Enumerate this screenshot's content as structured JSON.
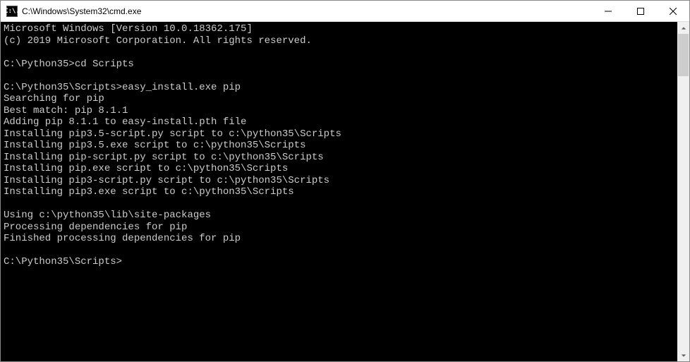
{
  "window": {
    "title": "C:\\Windows\\System32\\cmd.exe",
    "icon_text": "C:\\."
  },
  "terminal": {
    "lines": [
      "Microsoft Windows [Version 10.0.18362.175]",
      "(c) 2019 Microsoft Corporation. All rights reserved.",
      "",
      "C:\\Python35>cd Scripts",
      "",
      "C:\\Python35\\Scripts>easy_install.exe pip",
      "Searching for pip",
      "Best match: pip 8.1.1",
      "Adding pip 8.1.1 to easy-install.pth file",
      "Installing pip3.5-script.py script to c:\\python35\\Scripts",
      "Installing pip3.5.exe script to c:\\python35\\Scripts",
      "Installing pip-script.py script to c:\\python35\\Scripts",
      "Installing pip.exe script to c:\\python35\\Scripts",
      "Installing pip3-script.py script to c:\\python35\\Scripts",
      "Installing pip3.exe script to c:\\python35\\Scripts",
      "",
      "Using c:\\python35\\lib\\site-packages",
      "Processing dependencies for pip",
      "Finished processing dependencies for pip",
      "",
      "C:\\Python35\\Scripts>"
    ]
  }
}
